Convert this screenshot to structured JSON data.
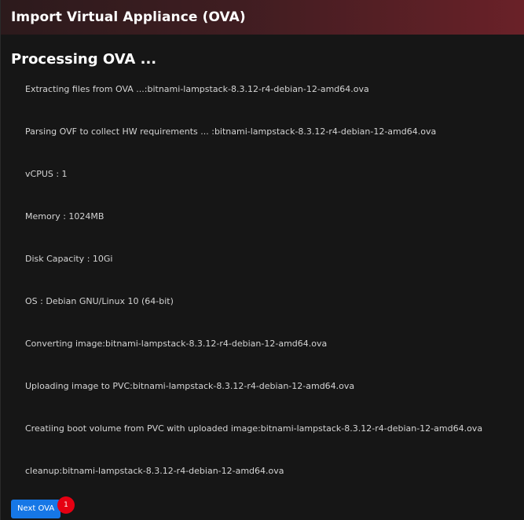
{
  "dialog": {
    "title": "Import Virtual Appliance (OVA)",
    "heading": "Processing OVA ..."
  },
  "steps": [
    "Extracting files from OVA ...:bitnami-lampstack-8.3.12-r4-debian-12-amd64.ova",
    "Parsing OVF to collect HW requirements ... :bitnami-lampstack-8.3.12-r4-debian-12-amd64.ova",
    "vCPUS : 1",
    "Memory : 1024MB",
    "Disk Capacity : 10Gi",
    "OS : Debian GNU/Linux 10 (64-bit)",
    "Converting image:bitnami-lampstack-8.3.12-r4-debian-12-amd64.ova",
    "Uploading image to PVC:bitnami-lampstack-8.3.12-r4-debian-12-amd64.ova",
    "Creatiing boot volume from PVC with uploaded image:bitnami-lampstack-8.3.12-r4-debian-12-amd64.ova",
    "cleanup:bitnami-lampstack-8.3.12-r4-debian-12-amd64.ova"
  ],
  "actions": {
    "next_label": "Next OVA",
    "badge": "1"
  },
  "colors": {
    "accent": "#1677e6",
    "badge": "#e60012",
    "title_gradient_end": "#6a2128"
  }
}
